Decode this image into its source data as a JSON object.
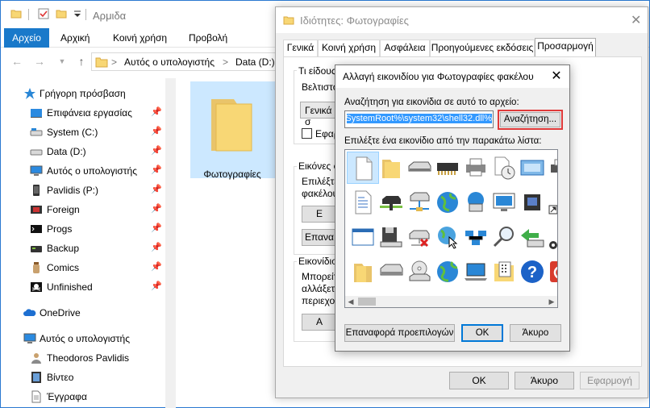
{
  "window": {
    "title": "Αρμιδα",
    "accent": "#1979ca"
  },
  "ribbon": {
    "tabs": [
      "Αρχείο",
      "Αρχική",
      "Κοινή χρήση",
      "Προβολή"
    ]
  },
  "address": {
    "crumbs": [
      "Αυτός ο υπολογιστής",
      "Data (D:)"
    ],
    "separator": ">"
  },
  "nav": {
    "items": [
      {
        "label": "Γρήγορη πρόσβαση",
        "icon": "star-icon"
      },
      {
        "label": "Επιφάνεια εργασίας",
        "icon": "desktop-icon"
      },
      {
        "label": "System (C:)",
        "icon": "drive-icon"
      },
      {
        "label": "Data (D:)",
        "icon": "drive-icon"
      },
      {
        "label": "Αυτός ο υπολογιστής",
        "icon": "computer-icon"
      },
      {
        "label": "Pavlidis (P:)",
        "icon": "phone-icon"
      },
      {
        "label": "Foreign",
        "icon": "film-icon"
      },
      {
        "label": "Progs",
        "icon": "console-icon"
      },
      {
        "label": "Backup",
        "icon": "drive-icon"
      },
      {
        "label": "Comics",
        "icon": "jar-icon"
      },
      {
        "label": "Unfinished",
        "icon": "pirate-flag-icon"
      },
      {
        "label": "OneDrive",
        "icon": "cloud-icon"
      },
      {
        "label": "Αυτός ο υπολογιστής",
        "icon": "computer-icon"
      },
      {
        "label": "Theodoros Pavlidis",
        "icon": "user-icon"
      },
      {
        "label": "Βίντεο",
        "icon": "film-icon"
      },
      {
        "label": "Έγγραφα",
        "icon": "document-icon"
      }
    ]
  },
  "content": {
    "folder_name": "Φωτογραφίες"
  },
  "properties": {
    "title": "Ιδιότητες: Φωτογραφίες",
    "tabs": [
      "Γενικά",
      "Κοινή χρήση",
      "Ασφάλεια",
      "Προηγούμενες εκδόσεις",
      "Προσαρμογή"
    ],
    "active_tab": "Προσαρμογή",
    "fragments": {
      "group1_label": "Τι είδους",
      "group1_line": "Βελτιστο",
      "group1_select": "Γενικά σ",
      "group1_checkbox": "Εφαρ",
      "group2_label": "Εικόνες φ",
      "group2_line1": "Επιλέξτε",
      "group2_line2": "φακέλου",
      "group2_btn1": "Ε",
      "group2_btn2": "Επανα",
      "group3_label": "Εικονίδιο",
      "group3_line1": "Μπορείτ",
      "group3_line2": "αλλάξετ",
      "group3_line3": "περιεχομ",
      "group3_btn": "Α"
    },
    "ok_label": "OK",
    "cancel_label": "Άκυρο",
    "apply_label": "Εφαρμογή"
  },
  "change_icon": {
    "title": "Αλλαγή εικονιδίου για Φωτογραφίες φακέλου",
    "search_label": "Αναζήτηση για εικονίδια σε αυτό το αρχείο:",
    "path_value": "%SystemRoot%\\system32\\shell32.dll",
    "browse_label": "Αναζήτηση...",
    "list_label": "Επιλέξτε ένα εικονίδιο από την παρακάτω λίστα:",
    "restore_label": "Επαναφορά προεπιλογών",
    "ok_label": "OK",
    "cancel_label": "Άκυρο",
    "icons": [
      [
        "blank-document-icon",
        "folder-icon",
        "drive-icon",
        "chip-icon",
        "printer-icon",
        "clock-document-icon",
        "window-icon"
      ],
      [
        "text-document-icon",
        "network-drive-icon",
        "network-server-icon",
        "globe-icon",
        "network-computer-icon",
        "monitor-icon",
        "printer-icon"
      ],
      [
        "window-icon",
        "floppy-icon",
        "disconnected-drive-icon",
        "globe-cursor-icon",
        "network-icon",
        "magnifier-icon",
        "green-arrow-icon"
      ],
      [
        "folder-icon",
        "drive-icon",
        "cd-drive-icon",
        "globe-icon",
        "laptop-icon",
        "calculator-icon",
        "help-icon",
        "power-icon"
      ]
    ]
  }
}
